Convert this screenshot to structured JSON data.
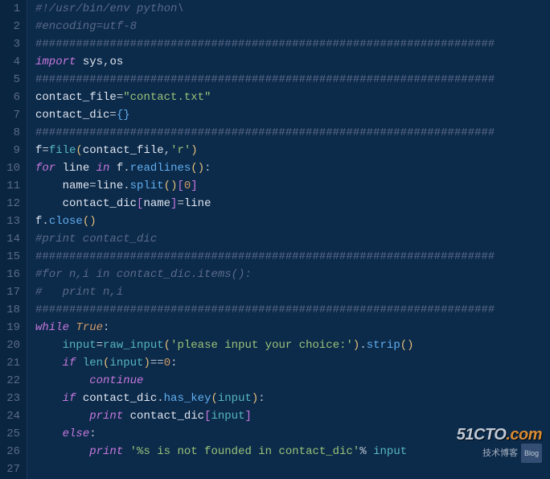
{
  "watermark": {
    "main_prefix": "51CTO",
    "main_suffix": ".com",
    "subtitle": "技术博客",
    "tag": "Blog"
  },
  "lines": [
    {
      "n": 1,
      "tokens": [
        {
          "t": "#!/usr/bin/env python\\",
          "c": "c-comment"
        }
      ]
    },
    {
      "n": 2,
      "tokens": [
        {
          "t": "#encoding=utf-8",
          "c": "c-comment"
        }
      ]
    },
    {
      "n": 3,
      "tokens": [
        {
          "t": "####################################################################",
          "c": "c-hash"
        }
      ]
    },
    {
      "n": 4,
      "tokens": [
        {
          "t": "import",
          "c": "c-keyword"
        },
        {
          "t": " ",
          "c": "c-op"
        },
        {
          "t": "sys",
          "c": "c-ident"
        },
        {
          "t": ",",
          "c": "c-op"
        },
        {
          "t": "os",
          "c": "c-ident"
        }
      ]
    },
    {
      "n": 5,
      "tokens": [
        {
          "t": "####################################################################",
          "c": "c-hash"
        }
      ]
    },
    {
      "n": 6,
      "tokens": [
        {
          "t": "contact_file",
          "c": "c-ident"
        },
        {
          "t": "=",
          "c": "c-op"
        },
        {
          "t": "\"contact.txt\"",
          "c": "c-string"
        }
      ]
    },
    {
      "n": 7,
      "tokens": [
        {
          "t": "contact_dic",
          "c": "c-ident"
        },
        {
          "t": "=",
          "c": "c-op"
        },
        {
          "t": "{",
          "c": "c-brace"
        },
        {
          "t": "}",
          "c": "c-brace"
        }
      ]
    },
    {
      "n": 8,
      "tokens": [
        {
          "t": "####################################################################",
          "c": "c-hash"
        }
      ]
    },
    {
      "n": 9,
      "tokens": [
        {
          "t": "f",
          "c": "c-ident"
        },
        {
          "t": "=",
          "c": "c-op"
        },
        {
          "t": "file",
          "c": "c-builtin"
        },
        {
          "t": "(",
          "c": "c-paren"
        },
        {
          "t": "contact_file",
          "c": "c-ident"
        },
        {
          "t": ",",
          "c": "c-op"
        },
        {
          "t": "'r'",
          "c": "c-string"
        },
        {
          "t": ")",
          "c": "c-paren"
        }
      ]
    },
    {
      "n": 10,
      "tokens": [
        {
          "t": "for",
          "c": "c-keyword"
        },
        {
          "t": " ",
          "c": "c-op"
        },
        {
          "t": "line",
          "c": "c-ident"
        },
        {
          "t": " ",
          "c": "c-op"
        },
        {
          "t": "in",
          "c": "c-keyword"
        },
        {
          "t": " ",
          "c": "c-op"
        },
        {
          "t": "f",
          "c": "c-ident"
        },
        {
          "t": ".",
          "c": "c-op"
        },
        {
          "t": "readlines",
          "c": "c-func"
        },
        {
          "t": "(",
          "c": "c-paren"
        },
        {
          "t": ")",
          "c": "c-paren"
        },
        {
          "t": ":",
          "c": "c-op"
        }
      ]
    },
    {
      "n": 11,
      "tokens": [
        {
          "t": "    ",
          "c": "c-op"
        },
        {
          "t": "name",
          "c": "c-ident"
        },
        {
          "t": "=",
          "c": "c-op"
        },
        {
          "t": "line",
          "c": "c-ident"
        },
        {
          "t": ".",
          "c": "c-op"
        },
        {
          "t": "split",
          "c": "c-func"
        },
        {
          "t": "(",
          "c": "c-paren"
        },
        {
          "t": ")",
          "c": "c-paren"
        },
        {
          "t": "[",
          "c": "c-bracket"
        },
        {
          "t": "0",
          "c": "c-num"
        },
        {
          "t": "]",
          "c": "c-bracket"
        }
      ]
    },
    {
      "n": 12,
      "tokens": [
        {
          "t": "    ",
          "c": "c-op"
        },
        {
          "t": "contact_dic",
          "c": "c-ident"
        },
        {
          "t": "[",
          "c": "c-bracket"
        },
        {
          "t": "name",
          "c": "c-ident"
        },
        {
          "t": "]",
          "c": "c-bracket"
        },
        {
          "t": "=",
          "c": "c-op"
        },
        {
          "t": "line",
          "c": "c-ident"
        }
      ]
    },
    {
      "n": 13,
      "tokens": [
        {
          "t": "f",
          "c": "c-ident"
        },
        {
          "t": ".",
          "c": "c-op"
        },
        {
          "t": "close",
          "c": "c-func"
        },
        {
          "t": "(",
          "c": "c-paren"
        },
        {
          "t": ")",
          "c": "c-paren"
        }
      ]
    },
    {
      "n": 14,
      "tokens": [
        {
          "t": "#print contact_dic",
          "c": "c-comment"
        }
      ]
    },
    {
      "n": 15,
      "tokens": [
        {
          "t": "####################################################################",
          "c": "c-hash"
        }
      ]
    },
    {
      "n": 16,
      "tokens": [
        {
          "t": "#for n,i in contact_dic.items():",
          "c": "c-comment"
        }
      ]
    },
    {
      "n": 17,
      "tokens": [
        {
          "t": "#   print n,i",
          "c": "c-comment"
        }
      ]
    },
    {
      "n": 18,
      "tokens": [
        {
          "t": "####################################################################",
          "c": "c-hash"
        }
      ]
    },
    {
      "n": 19,
      "tokens": [
        {
          "t": "while",
          "c": "c-keyword"
        },
        {
          "t": " ",
          "c": "c-op"
        },
        {
          "t": "True",
          "c": "c-const"
        },
        {
          "t": ":",
          "c": "c-op"
        }
      ]
    },
    {
      "n": 20,
      "tokens": [
        {
          "t": "    ",
          "c": "c-op"
        },
        {
          "t": "input",
          "c": "c-builtin"
        },
        {
          "t": "=",
          "c": "c-op"
        },
        {
          "t": "raw_input",
          "c": "c-builtin"
        },
        {
          "t": "(",
          "c": "c-paren"
        },
        {
          "t": "'please input your choice:'",
          "c": "c-string"
        },
        {
          "t": ")",
          "c": "c-paren"
        },
        {
          "t": ".",
          "c": "c-op"
        },
        {
          "t": "strip",
          "c": "c-func"
        },
        {
          "t": "(",
          "c": "c-paren"
        },
        {
          "t": ")",
          "c": "c-paren"
        }
      ]
    },
    {
      "n": 21,
      "tokens": [
        {
          "t": "    ",
          "c": "c-op"
        },
        {
          "t": "if",
          "c": "c-keyword"
        },
        {
          "t": " ",
          "c": "c-op"
        },
        {
          "t": "len",
          "c": "c-builtin"
        },
        {
          "t": "(",
          "c": "c-paren"
        },
        {
          "t": "input",
          "c": "c-builtin"
        },
        {
          "t": ")",
          "c": "c-paren"
        },
        {
          "t": "==",
          "c": "c-op"
        },
        {
          "t": "0",
          "c": "c-num"
        },
        {
          "t": ":",
          "c": "c-op"
        }
      ]
    },
    {
      "n": 22,
      "tokens": [
        {
          "t": "        ",
          "c": "c-op"
        },
        {
          "t": "continue",
          "c": "c-keyword"
        }
      ]
    },
    {
      "n": 23,
      "tokens": [
        {
          "t": "    ",
          "c": "c-op"
        },
        {
          "t": "if",
          "c": "c-keyword"
        },
        {
          "t": " ",
          "c": "c-op"
        },
        {
          "t": "contact_dic",
          "c": "c-ident"
        },
        {
          "t": ".",
          "c": "c-op"
        },
        {
          "t": "has_key",
          "c": "c-func"
        },
        {
          "t": "(",
          "c": "c-paren"
        },
        {
          "t": "input",
          "c": "c-builtin"
        },
        {
          "t": ")",
          "c": "c-paren"
        },
        {
          "t": ":",
          "c": "c-op"
        }
      ]
    },
    {
      "n": 24,
      "tokens": [
        {
          "t": "        ",
          "c": "c-op"
        },
        {
          "t": "print",
          "c": "c-keyword"
        },
        {
          "t": " ",
          "c": "c-op"
        },
        {
          "t": "contact_dic",
          "c": "c-ident"
        },
        {
          "t": "[",
          "c": "c-bracket"
        },
        {
          "t": "input",
          "c": "c-builtin"
        },
        {
          "t": "]",
          "c": "c-bracket"
        }
      ]
    },
    {
      "n": 25,
      "tokens": [
        {
          "t": "    ",
          "c": "c-op"
        },
        {
          "t": "else",
          "c": "c-keyword"
        },
        {
          "t": ":",
          "c": "c-op"
        }
      ]
    },
    {
      "n": 26,
      "tokens": [
        {
          "t": "        ",
          "c": "c-op"
        },
        {
          "t": "print",
          "c": "c-keyword"
        },
        {
          "t": " ",
          "c": "c-op"
        },
        {
          "t": "'%s is not founded in contact_dic'",
          "c": "c-string"
        },
        {
          "t": "%",
          "c": "c-op"
        },
        {
          "t": " ",
          "c": "c-op"
        },
        {
          "t": "input",
          "c": "c-builtin"
        }
      ]
    },
    {
      "n": 27,
      "tokens": []
    }
  ]
}
